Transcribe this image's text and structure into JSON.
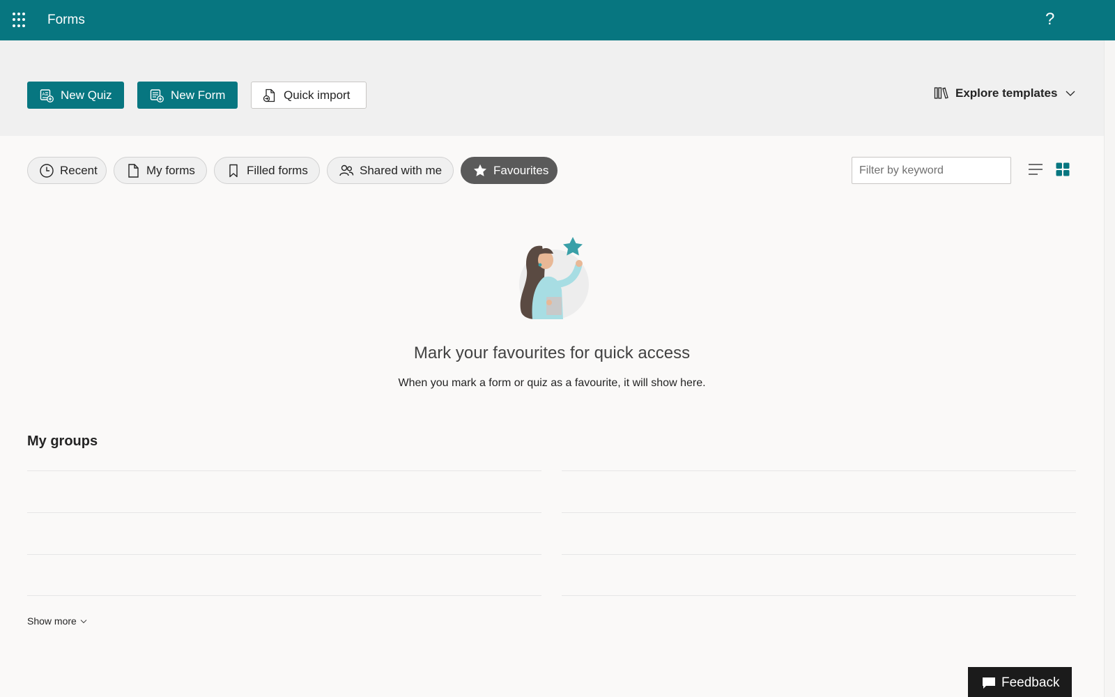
{
  "header": {
    "app_title": "Forms",
    "help_glyph": "?",
    "bg_color": "#077680"
  },
  "toolbar": {
    "new_quiz_label": "New Quiz",
    "new_form_label": "New Form",
    "quick_import_label": "Quick import",
    "explore_templates_label": "Explore templates"
  },
  "tabs": [
    {
      "label": "Recent",
      "icon": "clock-icon",
      "selected": false
    },
    {
      "label": "My forms",
      "icon": "document-icon",
      "selected": false
    },
    {
      "label": "Filled forms",
      "icon": "bookmark-icon",
      "selected": false
    },
    {
      "label": "Shared with me",
      "icon": "people-icon",
      "selected": false
    },
    {
      "label": "Favourites",
      "icon": "star-icon",
      "selected": true
    }
  ],
  "filter": {
    "placeholder": "Filter by keyword",
    "value": ""
  },
  "view_toggle": {
    "list_icon": "list-view-icon",
    "grid_icon": "grid-view-icon",
    "active": "grid"
  },
  "empty_state": {
    "title": "Mark your favourites for quick access",
    "subtitle": "When you mark a form or quiz as a favourite, it will show here."
  },
  "groups": {
    "heading": "My groups",
    "show_more_label": "Show more"
  },
  "feedback": {
    "label": "Feedback"
  },
  "colors": {
    "brand": "#077680",
    "selected_pill": "#5a5a5a",
    "star": "#3aa0a8"
  }
}
